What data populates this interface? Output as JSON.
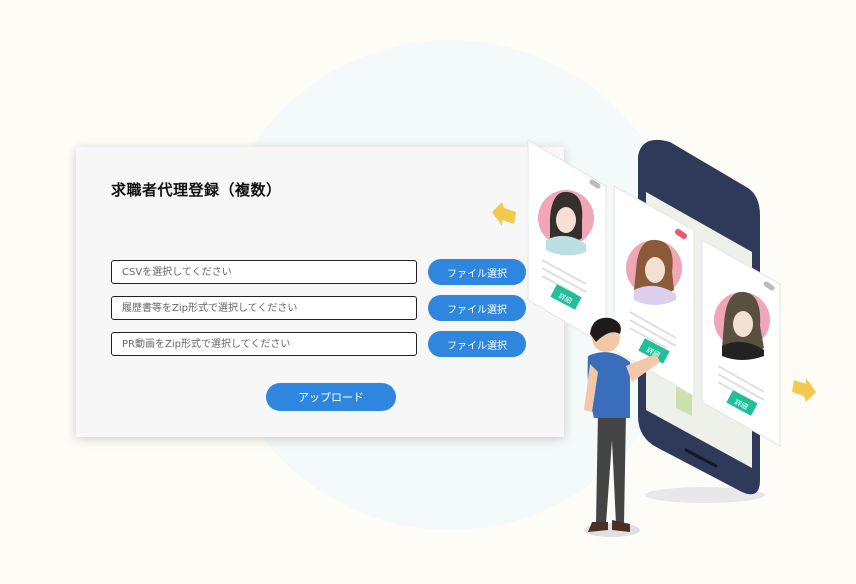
{
  "form": {
    "title": "求職者代理登録（複数）",
    "rows": [
      {
        "placeholder": "CSVを選択してください",
        "button_label": "ファイル選択"
      },
      {
        "placeholder": "履歴書等をZip形式で選択してください",
        "button_label": "ファイル選択"
      },
      {
        "placeholder": "PR動画をZip形式で選択してください",
        "button_label": "ファイル選択"
      }
    ],
    "upload_label": "アップロード"
  },
  "illustration": {
    "cards": [
      {
        "button_label": "詳細"
      },
      {
        "button_label": "詳細"
      },
      {
        "button_label": "詳細"
      }
    ]
  },
  "colors": {
    "accent": "#2e86de",
    "card_bg": "#f7f7f7",
    "page_bg": "#fdfcf7",
    "detail_button": "#1fbf9a",
    "arrow": "#f2c94c",
    "phone": "#2f3a5a"
  }
}
